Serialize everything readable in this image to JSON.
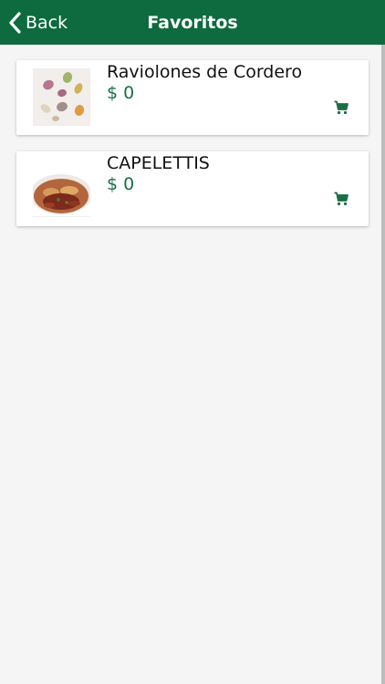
{
  "header": {
    "back_label": "Back",
    "title": "Favoritos"
  },
  "favorites": [
    {
      "name": "Raviolones de Cordero",
      "price": "$ 0",
      "image": "raviolones-photo"
    },
    {
      "name": "CAPELETTIS",
      "price": "$ 0",
      "image": "capelettis-photo"
    }
  ],
  "colors": {
    "brand_green": "#0e6b3f",
    "price_green": "#1a6e46",
    "background": "#f5f5f5"
  },
  "icons": {
    "back": "chevron-left-icon",
    "cart": "cart-icon"
  }
}
